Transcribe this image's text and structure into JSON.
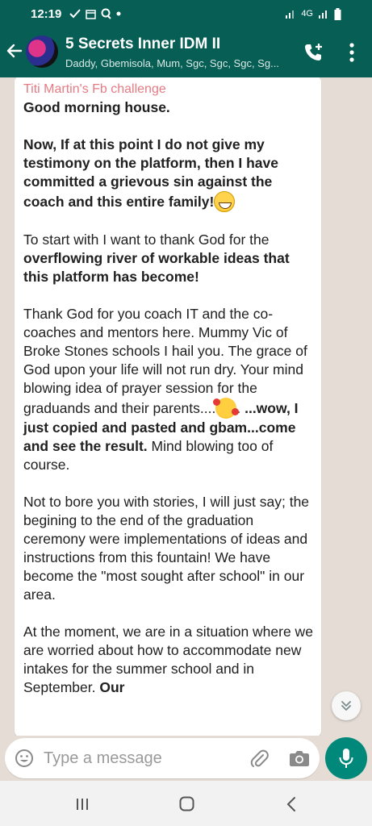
{
  "status_bar": {
    "time": "12:19",
    "left_icons": [
      "check-icon",
      "calendar-icon",
      "q-icon",
      "dot-icon"
    ],
    "network": "4G",
    "right_icons": [
      "signal-icon",
      "signal-4g-icon",
      "battery-icon"
    ]
  },
  "header": {
    "title": "5 Secrets Inner IDM II",
    "members": "Daddy, Gbemisola, Mum, Sgc, Sgc, Sgc, Sg..."
  },
  "message": {
    "sender": "Titi Martin's Fb challenge",
    "p1": "Good morning house.",
    "p2": "Now, If at this point I do not give my testimony on the platform, then I have committed a grievous sin against the coach and this entire family!",
    "p3_a": "To start with I want to thank God for the ",
    "p3_b": "overflowing river of workable ideas that this platform has become!",
    "p4_a": "Thank God for you coach IT and the co-coaches and mentors here.  Mummy Vic of Broke Stones schools I hail you. The grace of God upon your life will not run dry. Your mind blowing idea of prayer session for the graduands and their parents....",
    "p4_b": ". ",
    "p4_c": "...wow, I just copied and pasted and  gbam...come and see the result.",
    "p4_d": " Mind blowing too of course.",
    "p5": "Not to bore you with stories, I will just say; the begining to the end of the graduation ceremony were implementations of ideas and instructions from this fountain! We have become the \"most sought after school\" in our area.",
    "p6_a": "At the moment, we are in a situation where we are worried about how to accommodate new intakes for the summer school and in September. ",
    "p6_b": "Our"
  },
  "input": {
    "placeholder": "Type a message"
  },
  "colors": {
    "header": "#075e54",
    "accent": "#00897b",
    "sender_name": "#e57b84",
    "chat_bg": "#e5ddd5"
  }
}
